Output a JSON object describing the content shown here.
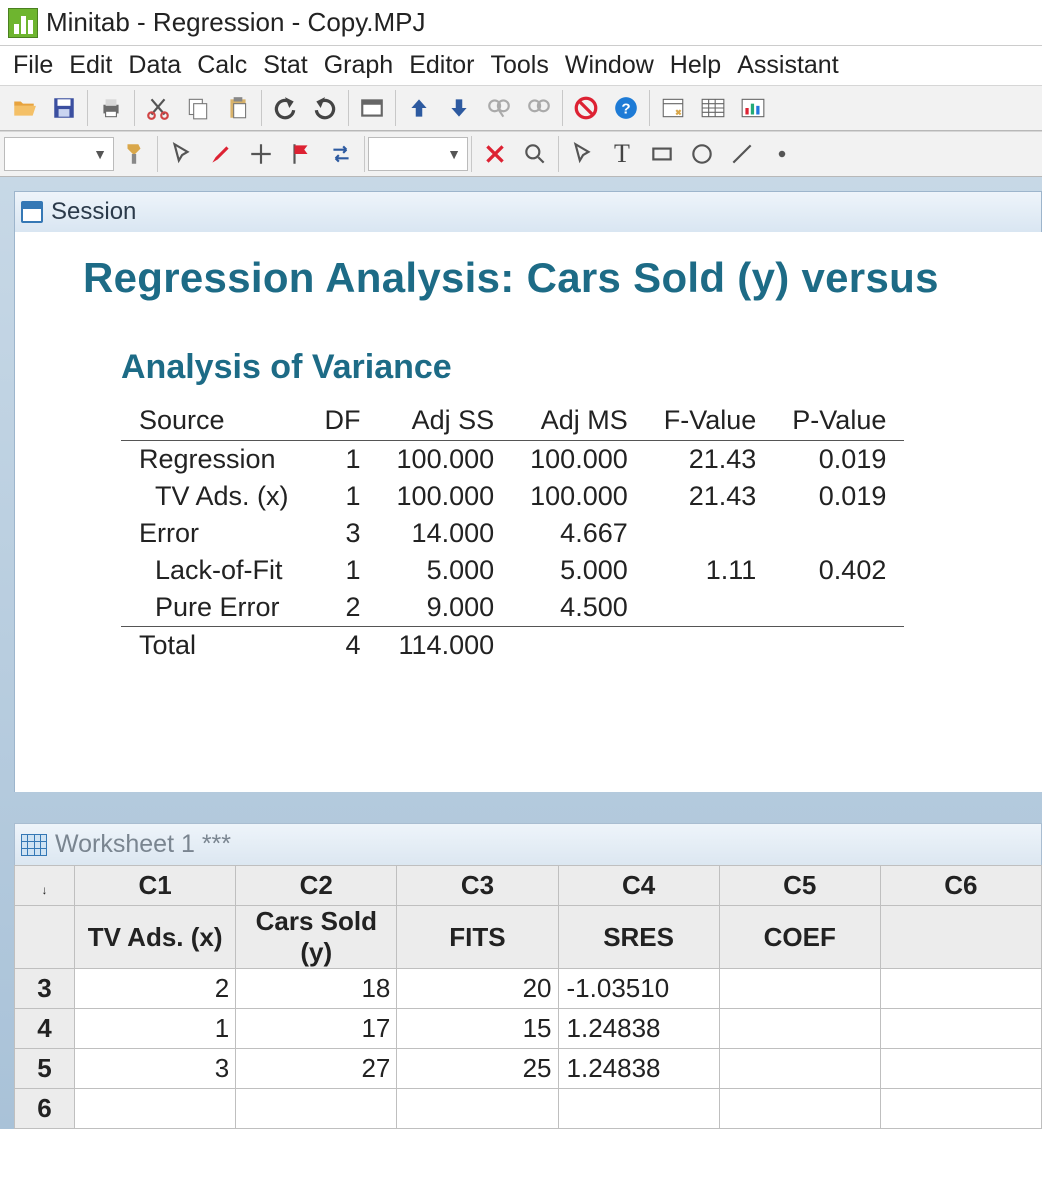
{
  "app": {
    "title": "Minitab - Regression - Copy.MPJ"
  },
  "menu": [
    "File",
    "Edit",
    "Data",
    "Calc",
    "Stat",
    "Graph",
    "Editor",
    "Tools",
    "Window",
    "Help",
    "Assistant"
  ],
  "session": {
    "window_label": "Session",
    "heading": "Regression Analysis: Cars Sold (y) versus ",
    "section": "Analysis of Variance",
    "columns": [
      "Source",
      "DF",
      "Adj SS",
      "Adj MS",
      "F-Value",
      "P-Value"
    ],
    "rows": [
      {
        "indent": 0,
        "source": "Regression",
        "df": "1",
        "adjss": "100.000",
        "adjms": "100.000",
        "f": "21.43",
        "p": "0.019"
      },
      {
        "indent": 1,
        "source": "TV Ads. (x)",
        "df": "1",
        "adjss": "100.000",
        "adjms": "100.000",
        "f": "21.43",
        "p": "0.019"
      },
      {
        "indent": 0,
        "source": "Error",
        "df": "3",
        "adjss": "14.000",
        "adjms": "4.667",
        "f": "",
        "p": ""
      },
      {
        "indent": 1,
        "source": "Lack-of-Fit",
        "df": "1",
        "adjss": "5.000",
        "adjms": "5.000",
        "f": "1.11",
        "p": "0.402"
      },
      {
        "indent": 1,
        "source": "Pure Error",
        "df": "2",
        "adjss": "9.000",
        "adjms": "4.500",
        "f": "",
        "p": ""
      },
      {
        "indent": 0,
        "source": "Total",
        "df": "4",
        "adjss": "114.000",
        "adjms": "",
        "f": "",
        "p": "",
        "total": true
      }
    ]
  },
  "worksheet": {
    "label": "Worksheet 1 ***",
    "col_ids": [
      "C1",
      "C2",
      "C3",
      "C4",
      "C5",
      "C6"
    ],
    "col_names": [
      "TV Ads. (x)",
      "Cars Sold (y)",
      "FITS",
      "SRES",
      "COEF",
      ""
    ],
    "row_labels": [
      "3",
      "4",
      "5",
      "6"
    ],
    "rows": [
      [
        "2",
        "18",
        "20",
        "-1.03510",
        "",
        ""
      ],
      [
        "1",
        "17",
        "15",
        "1.24838",
        "",
        ""
      ],
      [
        "3",
        "27",
        "25",
        "1.24838",
        "",
        ""
      ],
      [
        "",
        "",
        "",
        "",
        "",
        ""
      ]
    ]
  },
  "chart_data": {
    "type": "table",
    "title": "Analysis of Variance",
    "columns": [
      "Source",
      "DF",
      "Adj SS",
      "Adj MS",
      "F-Value",
      "P-Value"
    ],
    "data": [
      [
        "Regression",
        1,
        100.0,
        100.0,
        21.43,
        0.019
      ],
      [
        "  TV Ads. (x)",
        1,
        100.0,
        100.0,
        21.43,
        0.019
      ],
      [
        "Error",
        3,
        14.0,
        4.667,
        null,
        null
      ],
      [
        "  Lack-of-Fit",
        1,
        5.0,
        5.0,
        1.11,
        0.402
      ],
      [
        "  Pure Error",
        2,
        9.0,
        4.5,
        null,
        null
      ],
      [
        "Total",
        4,
        114.0,
        null,
        null,
        null
      ]
    ]
  }
}
